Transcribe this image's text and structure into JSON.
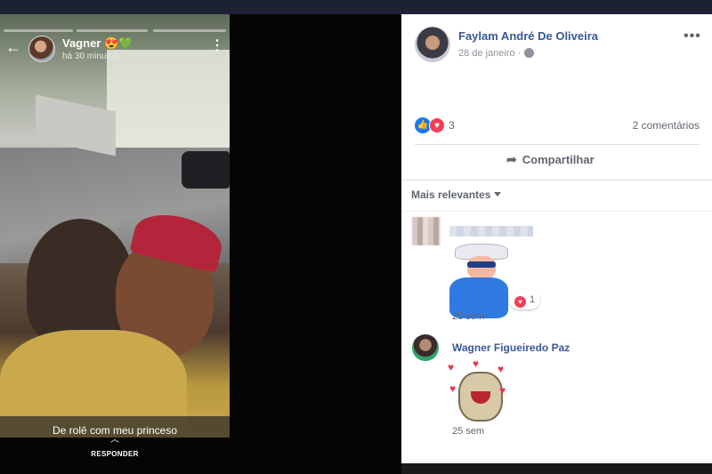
{
  "story": {
    "author": "Vagner 😍💚",
    "time": "há 30 minutos",
    "caption": "De rolê com meu princeso",
    "reply_label": "RESPONDER"
  },
  "post": {
    "author": "Faylam André De Oliveira",
    "date": "28 de janeiro ·",
    "reaction_count": "3",
    "comment_count": "2 comentários",
    "share_label": "Compartilhar",
    "sort_label": "Mais relevantes"
  },
  "comments": [
    {
      "time": "25 sem",
      "reaction_count": "1"
    },
    {
      "author": "Wagner Figueiredo Paz",
      "time": "25 sem"
    }
  ],
  "colors": {
    "link_blue": "#385898",
    "like_blue": "#1877f2",
    "love_red": "#f33e58"
  }
}
